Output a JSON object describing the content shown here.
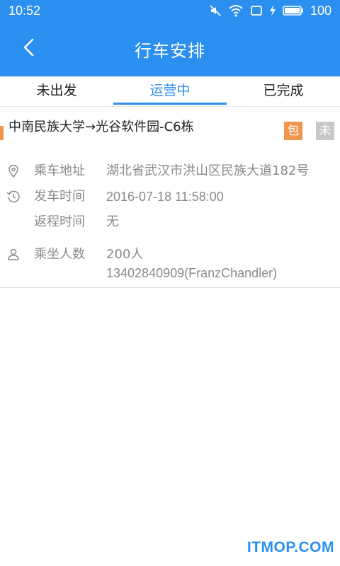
{
  "status_bar": {
    "time": "10:52",
    "battery": "100",
    "icons": [
      "mute-icon",
      "wifi-icon",
      "screen-icon",
      "charging-icon",
      "battery-icon"
    ]
  },
  "header": {
    "title": "行车安排",
    "back_icon": "chevron-left-icon"
  },
  "tabs": [
    {
      "label": "未出发",
      "active": false
    },
    {
      "label": "运营中",
      "active": true
    },
    {
      "label": "已完成",
      "active": false
    }
  ],
  "trip": {
    "route": "中南民族大学→光谷软件园-C6栋",
    "badge_charter": "包",
    "badge_status": "未",
    "rows": {
      "address": {
        "icon": "location-pin-icon",
        "label": "乘车地址",
        "value": "湖北省武汉市洪山区民族大道182号"
      },
      "depart": {
        "icon": "clock-icon",
        "label": "发车时间",
        "value": "2016-07-18 11:58:00"
      },
      "return": {
        "label": "返程时间",
        "value": "无"
      },
      "passengers": {
        "icon": "person-icon",
        "label": "乘坐人数",
        "value": "200人",
        "contact": "13402840909(FranzChandler)"
      }
    }
  },
  "watermark": "ITMOP.COM",
  "colors": {
    "primary": "#2b8ff0",
    "accent_orange": "#f0954d",
    "muted_gray": "#c8c8c8",
    "text_gray": "#8a8a8a"
  }
}
